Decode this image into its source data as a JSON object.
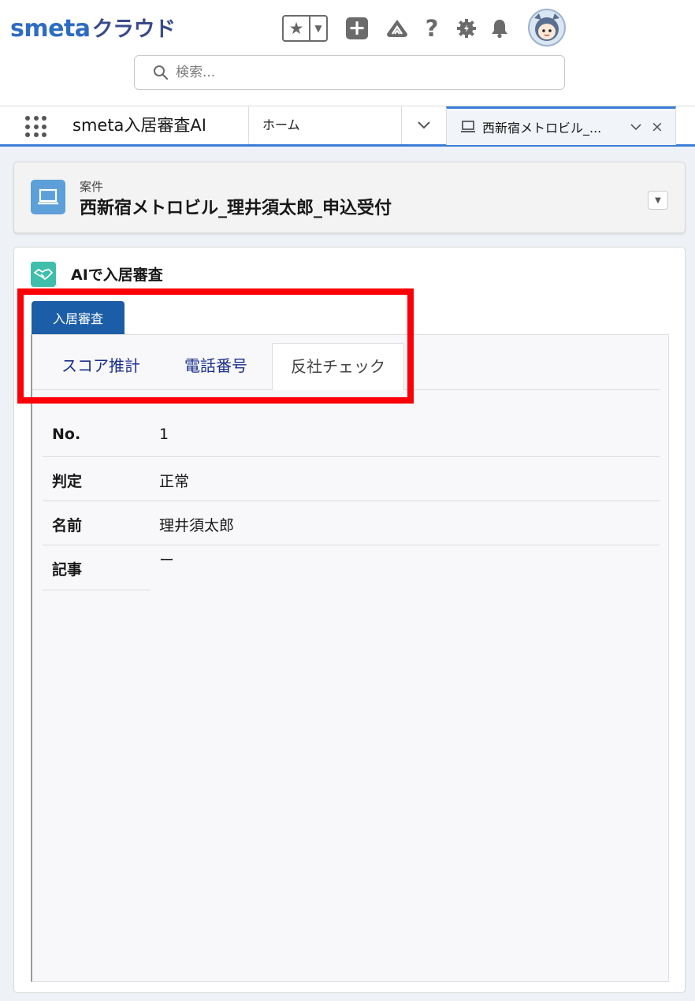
{
  "header": {
    "logo_main": "smeta",
    "logo_sub": "クラウド",
    "search": {
      "placeholder": "検索..."
    },
    "icons": [
      "star-icon",
      "chevron-down-icon",
      "plus-icon",
      "trailhead-icon",
      "help-icon",
      "gear-icon",
      "bell-icon",
      "avatar"
    ]
  },
  "nav": {
    "app_name": "smeta入居審査AI",
    "home_label": "ホーム",
    "open_tab_label": "西新宿メトロビル_..."
  },
  "record": {
    "type_label": "案件",
    "title": "西新宿メトロビル_理井須太郎_申込受付"
  },
  "card": {
    "title": "AIで入居審査",
    "outer_tab": "入居審査",
    "inner_tabs": [
      "スコア推計",
      "電話番号",
      "反社チェック"
    ],
    "active_inner_tab": "反社チェック",
    "details": [
      {
        "label": "No.",
        "value": "1"
      },
      {
        "label": "判定",
        "value": "正常"
      },
      {
        "label": "名前",
        "value": "理井須太郎"
      },
      {
        "label": "記事",
        "value": "ー"
      }
    ]
  },
  "colors": {
    "accent": "#3b7dd8",
    "brand_logo": "#2e6cc2",
    "outer_tab_bg": "#1b5ea7",
    "record_icon_bg": "#5d9fd8",
    "card_icon_bg": "#3fbfab",
    "highlight": "#fb0007"
  }
}
